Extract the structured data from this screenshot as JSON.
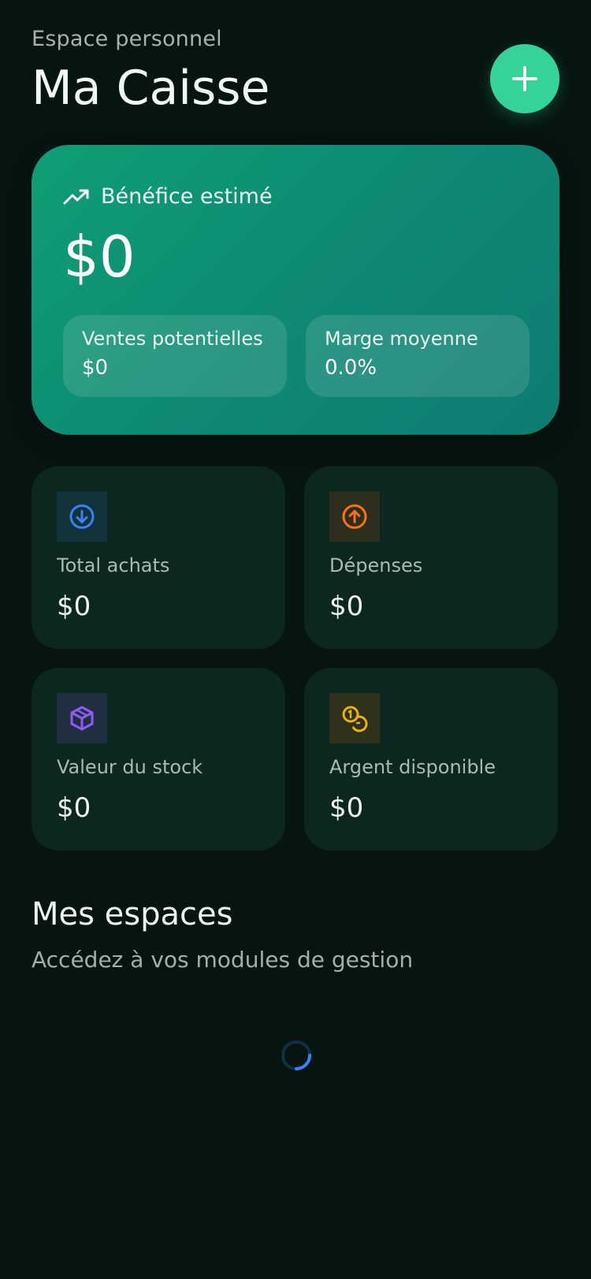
{
  "header": {
    "eyebrow": "Espace personnel",
    "title": "Ma Caisse",
    "add_button_icon": "plus-icon"
  },
  "hero": {
    "label": "Bénéfice estimé",
    "icon": "trending-up-icon",
    "value": "$0",
    "potential_sales": {
      "label": "Ventes potentielles",
      "value": "$0"
    },
    "average_margin": {
      "label": "Marge moyenne",
      "value": "0.0%"
    }
  },
  "stats": [
    {
      "label": "Total achats",
      "value": "$0",
      "icon": "arrow-down-circle-icon",
      "color": "#3b82f6",
      "bg": "#11333a"
    },
    {
      "label": "Dépenses",
      "value": "$0",
      "icon": "arrow-up-circle-icon",
      "color": "#f97316",
      "bg": "#2d2e1e"
    },
    {
      "label": "Valeur du stock",
      "value": "$0",
      "icon": "box-icon",
      "color": "#8b5cf6",
      "bg": "#1f2f40"
    },
    {
      "label": "Argent disponible",
      "value": "$0",
      "icon": "coins-icon",
      "color": "#eab308",
      "bg": "#2f311b"
    }
  ],
  "spaces": {
    "title": "Mes espaces",
    "subtitle": "Accédez à vos modules de gestion"
  },
  "colors": {
    "accent": "#34d399",
    "background": "#061512",
    "card": "#0d2720",
    "spinner": "#3b82f6"
  }
}
